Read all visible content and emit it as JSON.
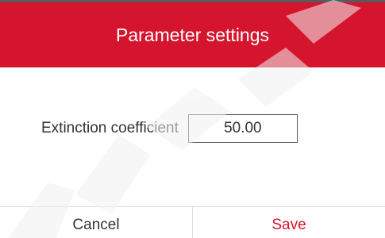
{
  "dialog": {
    "title": "Parameter settings"
  },
  "field": {
    "label": "Extinction coefficient",
    "value": "50.00"
  },
  "footer": {
    "cancel_label": "Cancel",
    "save_label": "Save"
  },
  "colors": {
    "accent": "#d5152d",
    "text": "#333333",
    "divider": "#dddddd"
  }
}
